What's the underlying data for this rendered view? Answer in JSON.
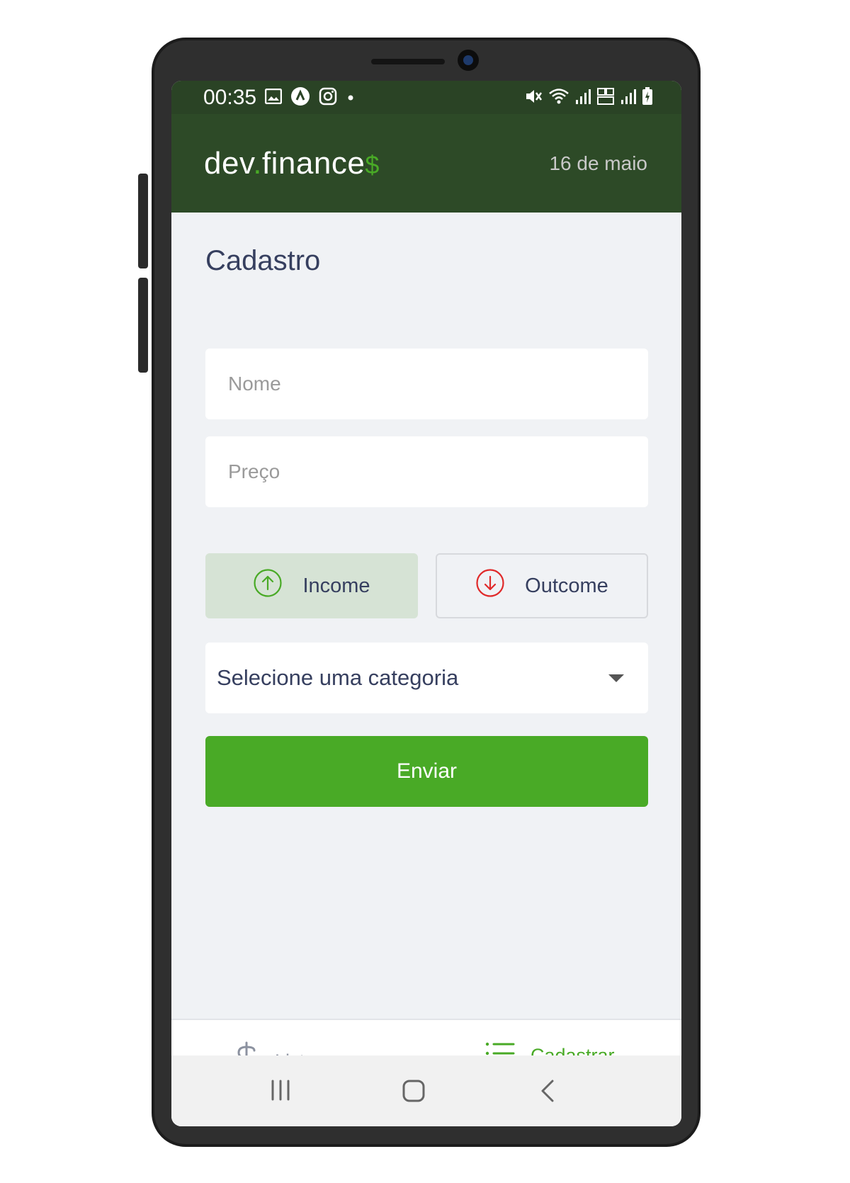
{
  "status_bar": {
    "time": "00:35"
  },
  "header": {
    "logo_main": "dev",
    "logo_dot": ".",
    "logo_rest": "finance",
    "logo_symbol": "$",
    "date": "16 de maio"
  },
  "page": {
    "title": "Cadastro"
  },
  "form": {
    "name_placeholder": "Nome",
    "price_placeholder": "Preço",
    "income_label": "Income",
    "outcome_label": "Outcome",
    "category_selected": "Selecione uma categoria",
    "submit_label": "Enviar"
  },
  "bottom_nav": {
    "items": [
      {
        "label": "Listagem",
        "icon": "dollar-icon",
        "active": false
      },
      {
        "label": "Cadastrar",
        "icon": "list-icon",
        "active": true
      }
    ]
  },
  "colors": {
    "brand_dark": "#2d4a27",
    "accent": "#49aa26",
    "income": "#49aa26",
    "outcome": "#e02a2a",
    "text": "#363f5f"
  }
}
